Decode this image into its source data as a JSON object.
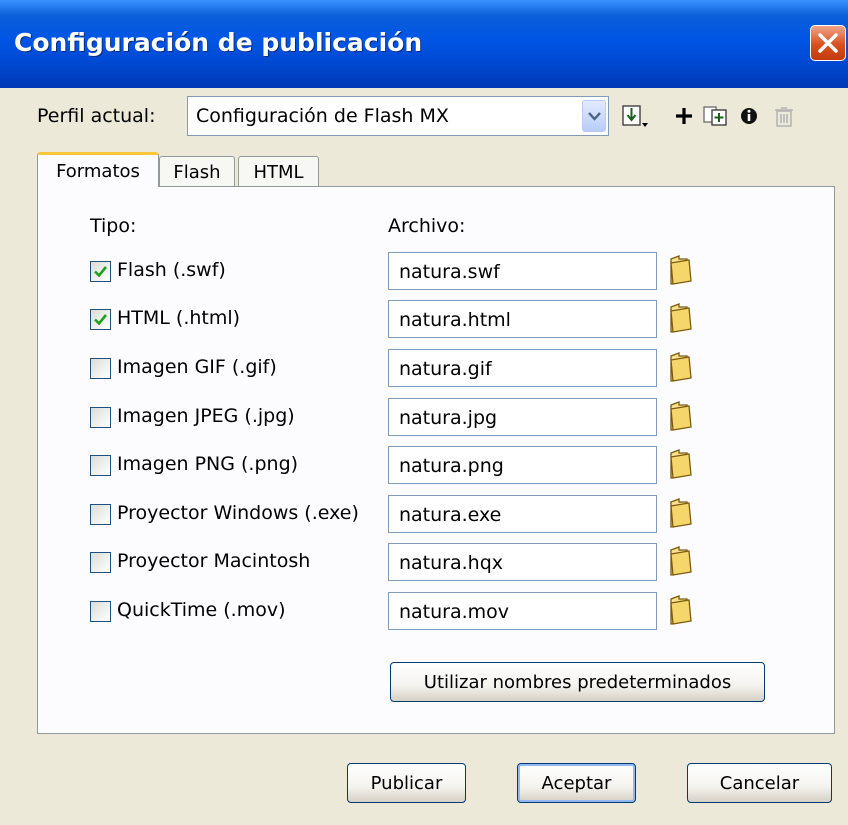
{
  "window": {
    "title": "Configuración de publicación"
  },
  "profile": {
    "label": "Perfil actual:",
    "value": "Configuración de Flash MX"
  },
  "toolbar": [
    "import-export-icon",
    "add-icon",
    "duplicate-icon",
    "info-icon",
    "delete-icon"
  ],
  "tabs": [
    {
      "label": "Formatos",
      "active": true
    },
    {
      "label": "Flash",
      "active": false
    },
    {
      "label": "HTML",
      "active": false
    }
  ],
  "headers": {
    "type": "Tipo:",
    "file": "Archivo:"
  },
  "formats": [
    {
      "label": "Flash  (.swf)",
      "checked": true,
      "file": "natura.swf"
    },
    {
      "label": "HTML (.html)",
      "checked": true,
      "file": "natura.html"
    },
    {
      "label": "Imagen GIF (.gif)",
      "checked": false,
      "file": "natura.gif"
    },
    {
      "label": "Imagen JPEG (.jpg)",
      "checked": false,
      "file": "natura.jpg"
    },
    {
      "label": "Imagen PNG (.png)",
      "checked": false,
      "file": "natura.png"
    },
    {
      "label": "Proyector Windows (.exe)",
      "checked": false,
      "file": "natura.exe"
    },
    {
      "label": "Proyector Macintosh",
      "checked": false,
      "file": "natura.hqx"
    },
    {
      "label": "QuickTime (.mov)",
      "checked": false,
      "file": "natura.mov"
    }
  ],
  "buttons": {
    "defaults": "Utilizar nombres predeterminados",
    "publish": "Publicar",
    "ok": "Aceptar",
    "cancel": "Cancelar"
  },
  "colors": {
    "titlebar": "#0055e5",
    "close": "#d9501e",
    "check": "#21a121",
    "folder": "#f5d66b",
    "tab_accent": "#ffc83c"
  }
}
